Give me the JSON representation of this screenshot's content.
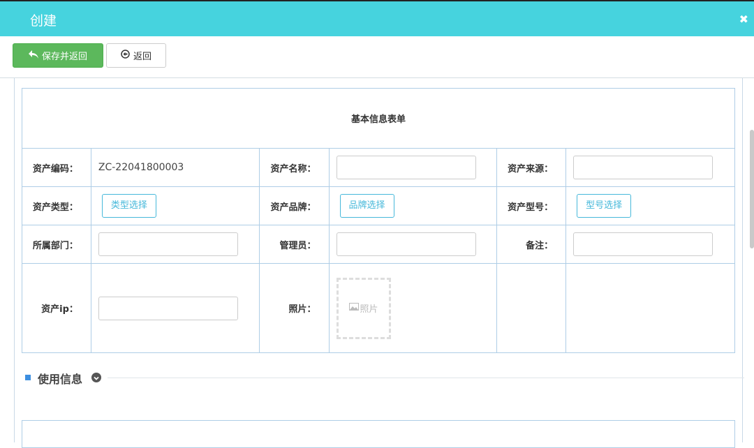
{
  "dialog": {
    "title": "创建",
    "close_icon": "close-icon"
  },
  "toolbar": {
    "save_label": "保存并返回",
    "back_label": "返回"
  },
  "form": {
    "heading": "基本信息表单",
    "asset_code_label": "资产编码：",
    "asset_code_value": "ZC-22041800003",
    "asset_name_label": "资产名称：",
    "asset_source_label": "资产来源：",
    "asset_type_label": "资产类型：",
    "asset_type_button": "类型选择",
    "asset_brand_label": "资产品牌：",
    "asset_brand_button": "品牌选择",
    "asset_model_label": "资产型号：",
    "asset_model_button": "型号选择",
    "department_label": "所属部门：",
    "admin_label": "管理员：",
    "remark_label": "备注：",
    "ip_label": "资产ip：",
    "photo_label": "照片：",
    "photo_placeholder": "照片"
  },
  "section": {
    "title": "使用信息"
  },
  "colors": {
    "header": "#46d3de",
    "save": "#5cb85c",
    "accent": "#46b8da",
    "border": "#aecde6"
  }
}
